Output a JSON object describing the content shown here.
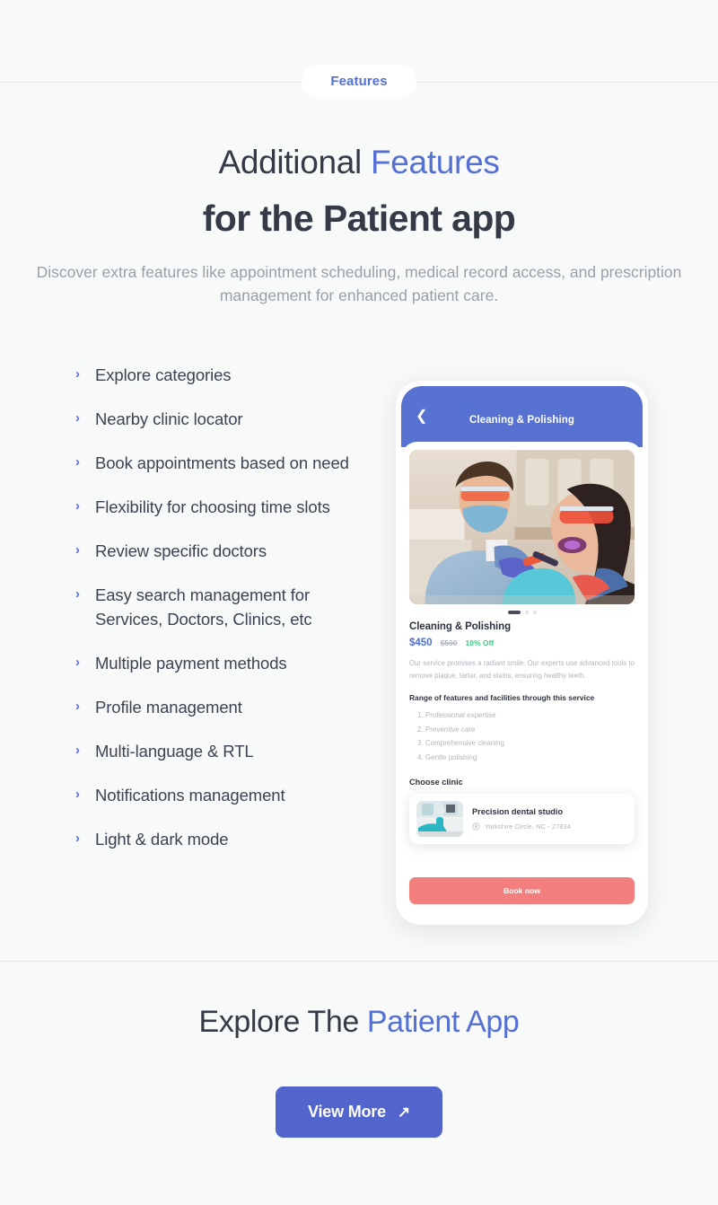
{
  "theme": {
    "page_bg": "#f8f9f9",
    "accent_blue": "#5570d4",
    "button_blue": "#5265cc",
    "appbar_blue": "#5772d0",
    "coral": "#f27f7d",
    "green": "#3ec97f",
    "heading_dark": "#343a46",
    "muted_gray": "#9a9fa8"
  },
  "badge": {
    "label": "Features"
  },
  "hero": {
    "title_line1_plain": "Additional ",
    "title_line1_accent": "Features",
    "title_line2": "for the Patient app",
    "subtitle": "Discover extra features like appointment scheduling, medical record access, and prescription management for enhanced patient care."
  },
  "features": {
    "bullet_icon": "chevron-right-icon",
    "items": [
      {
        "label": "Explore categories"
      },
      {
        "label": "Nearby clinic locator"
      },
      {
        "label": "Book appointments based on need"
      },
      {
        "label": "Flexibility for choosing time slots"
      },
      {
        "label": "Review specific doctors"
      },
      {
        "label": "Easy search management for Services, Doctors, Clinics, etc"
      },
      {
        "label": "Multiple payment methods"
      },
      {
        "label": "Profile management"
      },
      {
        "label": "Multi-language & RTL"
      },
      {
        "label": "Notifications management"
      },
      {
        "label": "Light & dark mode"
      }
    ]
  },
  "phone": {
    "appbar": {
      "back_icon": "chevron-left-icon",
      "title": "Cleaning & Polishing"
    },
    "carousel": {
      "active_index": 0,
      "count": 3
    },
    "service": {
      "title": "Cleaning & Polishing",
      "price_new": "$450",
      "price_old": "$500",
      "discount": "10% Off",
      "description": "Our service promises a radiant smile. Our experts use advanced tools to remove plaque, tartar, and stains, ensuring healthy teeth."
    },
    "features_block": {
      "heading": "Range of features and facilities through this service",
      "items": [
        "1. Professional expertise",
        "2. Preventive care",
        "3. Comprehensive cleaning",
        "4. Gentle polishing"
      ]
    },
    "clinic_block": {
      "heading": "Choose clinic",
      "name": "Precision dental studio",
      "location_icon": "map-pin-icon",
      "address": "Yorkshire Circle, NC - 27834"
    },
    "book_button": {
      "label": "Book now"
    }
  },
  "bottom": {
    "title_plain": "Explore The ",
    "title_accent": "Patient App",
    "button": {
      "label": "View More",
      "icon": "arrow-up-right-icon"
    }
  }
}
